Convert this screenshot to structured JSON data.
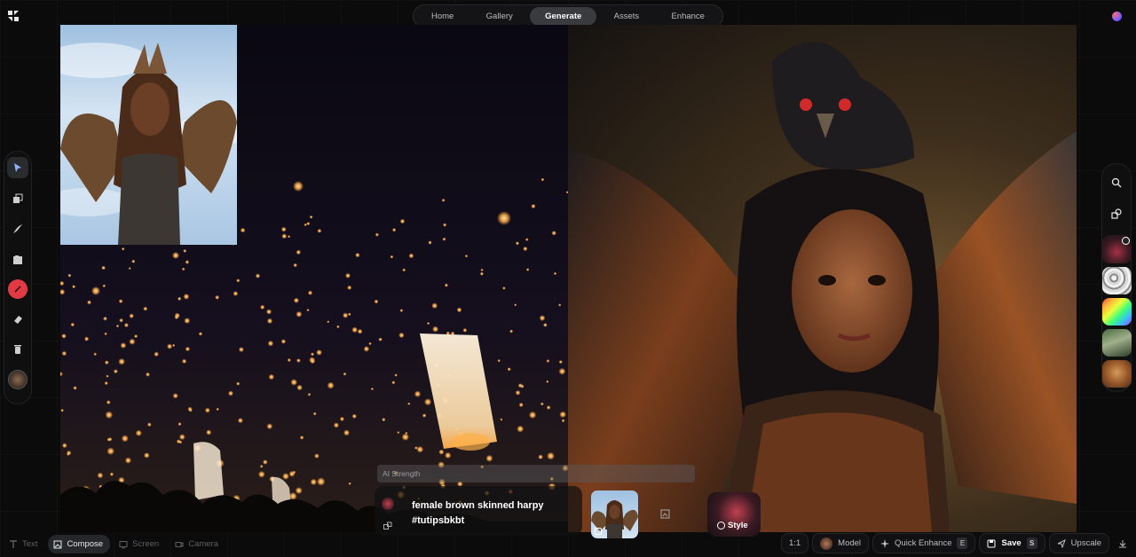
{
  "nav": {
    "tabs": [
      {
        "label": "Home",
        "active": false
      },
      {
        "label": "Gallery",
        "active": false
      },
      {
        "label": "Generate",
        "active": true
      },
      {
        "label": "Assets",
        "active": false
      },
      {
        "label": "Enhance",
        "active": false
      }
    ]
  },
  "left_toolbar": {
    "tools": [
      "pointer-icon",
      "layers-icon",
      "brush-icon",
      "image-icon",
      "color-picker-icon",
      "eraser-icon",
      "trash-icon",
      "user-thumb"
    ]
  },
  "right_toolbar": {
    "tools": [
      "search-icon",
      "shapes-icon"
    ],
    "style_swatches": 5
  },
  "prompt": {
    "ai_strength_label": "AI Strength",
    "text": "female brown skinned harpy #tutipsbkbt",
    "style_label": "Style"
  },
  "bottom_modes": [
    {
      "label": "Text",
      "active": false
    },
    {
      "label": "Compose",
      "active": true
    },
    {
      "label": "Screen",
      "active": false
    },
    {
      "label": "Camera",
      "active": false
    }
  ],
  "bottom_actions": {
    "aspect": "1:1",
    "model": "Model",
    "quick_enhance": "Quick Enhance",
    "quick_enhance_key": "E",
    "save": "Save",
    "save_key": "S",
    "upscale": "Upscale"
  },
  "colors": {
    "accent_red": "#e23a45",
    "active_tab_bg": "#3a3b3f"
  }
}
